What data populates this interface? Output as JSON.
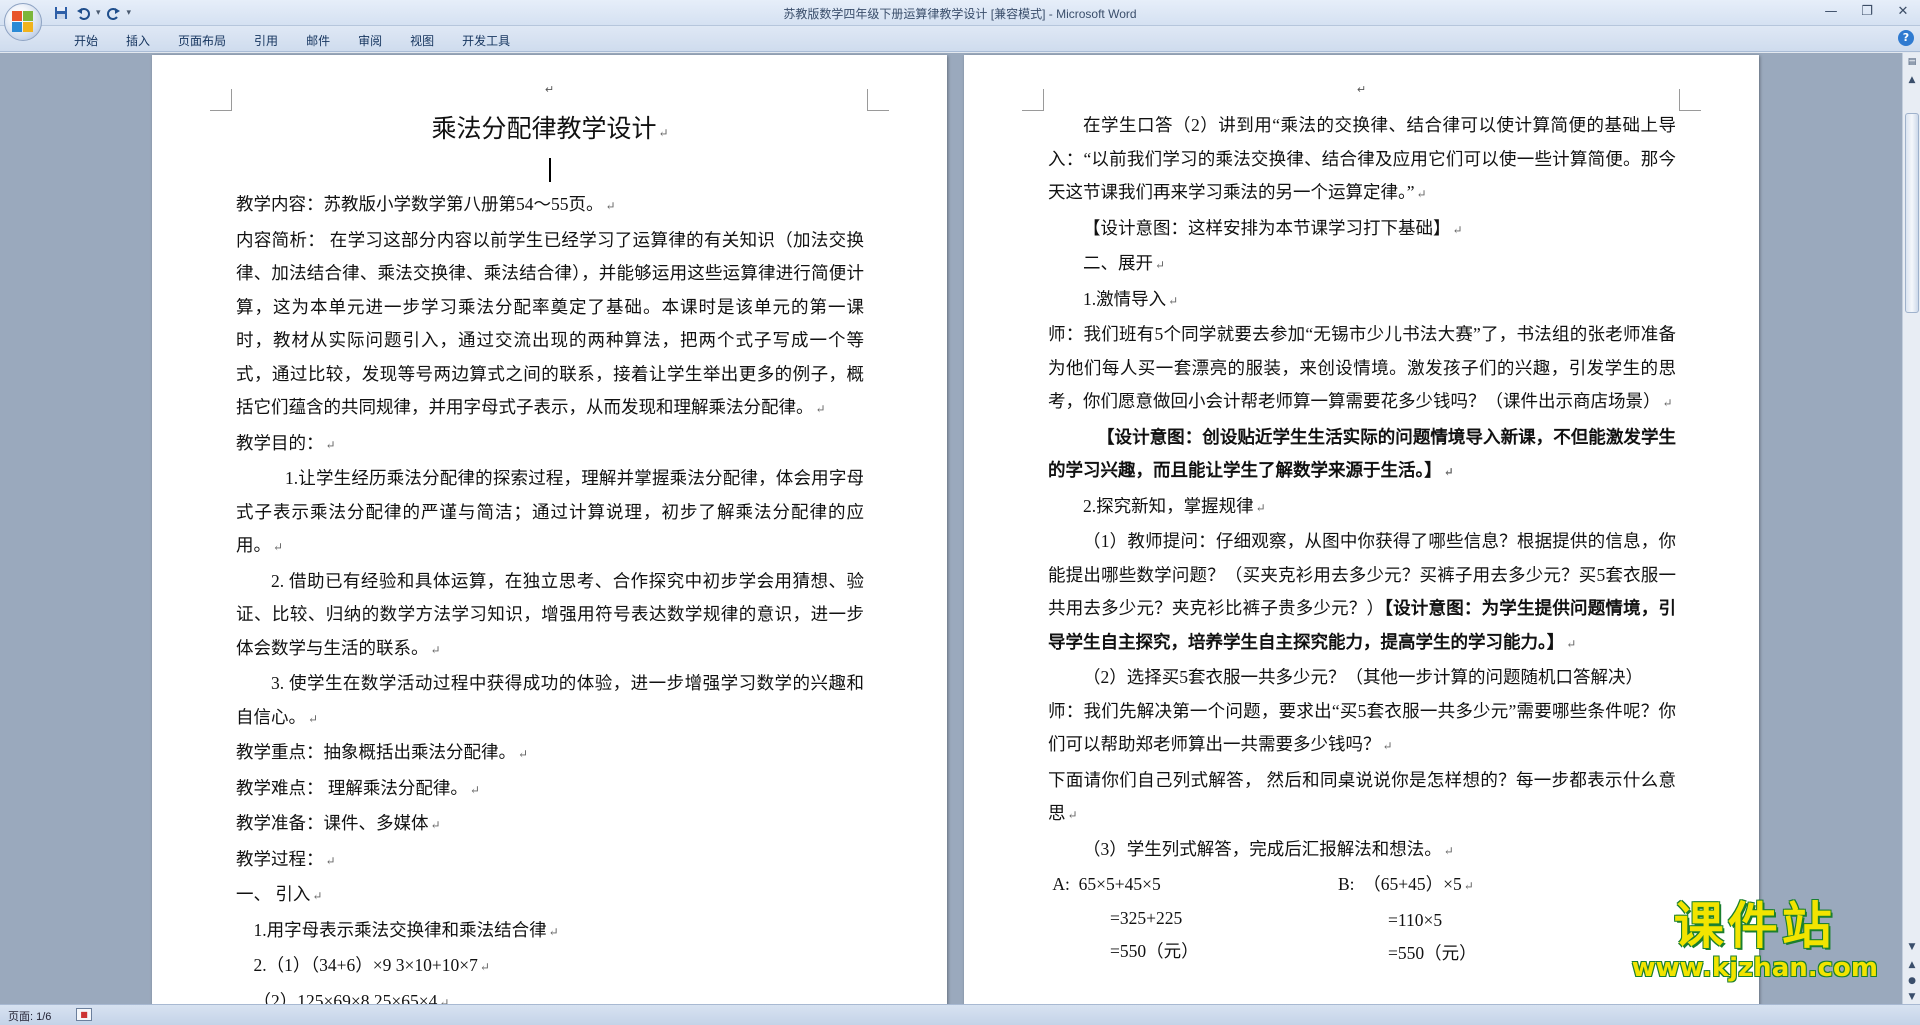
{
  "window": {
    "title": "苏教版数学四年级下册运算律教学设计 [兼容模式] - Microsoft Word"
  },
  "ribbon": {
    "tabs": [
      "开始",
      "插入",
      "页面布局",
      "引用",
      "邮件",
      "审阅",
      "视图",
      "开发工具"
    ]
  },
  "qat": {
    "save_icon": "save-icon",
    "undo_icon": "undo-icon",
    "redo_icon": "redo-icon"
  },
  "left_page": {
    "title": "乘法分配律教学设计",
    "paragraphs": [
      "教学内容：苏教版小学数学第八册第54～55页。",
      "内容简析： 在学习这部分内容以前学生已经学习了运算律的有关知识（加法交换律、加法结合律、乘法交换律、乘法结合律），并能够运用这些运算律进行简便计算，这为本单元进一步学习乘法分配率奠定了基础。本课时是该单元的第一课时，教材从实际问题引入，通过交流出现的两种算法，把两个式子写成一个等式，通过比较，发现等号两边算式之间的联系，接着让学生举出更多的例子，概括它们蕴含的共同规律，并用字母式子表示，从而发现和理解乘法分配律。",
      "教学目的：",
      "1.让学生经历乘法分配律的探索过程，理解并掌握乘法分配律，体会用字母式子表示乘法分配律的严谨与简洁；通过计算说理，初步了解乘法分配律的应用。",
      "2. 借助已有经验和具体运算，在独立思考、合作探究中初步学会用猜想、验证、比较、归纳的数学方法学习知识，增强用符号表达数学规律的意识，进一步体会数学与生活的联系。",
      "3. 使学生在数学活动过程中获得成功的体验，进一步增强学习数学的兴趣和自信心。",
      "教学重点：抽象概括出乘法分配律。",
      "教学难点： 理解乘法分配律。",
      "教学准备：课件、多媒体",
      "教学过程：",
      "一、 引入",
      "1.用字母表示乘法交换律和乘法结合律",
      "2.（1）（34+6）×9     3×10+10×7",
      "（2）125×69×8       25×65×4"
    ]
  },
  "right_page": {
    "paragraphs": [
      "在学生口答（2）讲到用“乘法的交换律、结合律可以使计算简便的基础上导入：“以前我们学习的乘法交换律、结合律及应用它们可以使一些计算简便。那今天这节课我们再来学习乘法的另一个运算定律。”",
      "【设计意图：这样安排为本节课学习打下基础】",
      "二、展开",
      "1.激情导入",
      "师：我们班有5个同学就要去参加“无锡市少儿书法大赛”了，书法组的张老师准备为他们每人买一套漂亮的服装，来创设情境。激发孩子们的兴趣，引发学生的思考，你们愿意做回小会计帮老师算一算需要花多少钱吗？（课件出示商店场景）",
      "【设计意图：创设贴近学生生活实际的问题情境导入新课，不但能激发学生的学习兴趣，而且能让学生了解数学来源于生活。】",
      "2.探究新知，掌握规律",
      "（1）教师提问：仔细观察，从图中你获得了哪些信息？根据提供的信息，你能提出哪些数学问题？（买夹克衫用去多少元？买裤子用去多少元？买5套衣服一共用去多少元？夹克衫比裤子贵多少元？）",
      "【设计意图：为学生提供问题情境，引导学生自主探究，培养学生自主探究能力，提高学生的学习能力。】",
      "（2）选择买5套衣服一共多少元？（其他一步计算的问题随机口答解决）",
      "师：我们先解决第一个问题，要求出“买5套衣服一共多少元”需要哪些条件呢？你们可以帮助郑老师算出一共需要多少钱吗？",
      "下面请你们自己列式解答， 然后和同桌说说你是怎样想的？每一步都表示什么意思",
      "（3）学生列式解答，完成后汇报解法和想法。"
    ],
    "equations": {
      "a_label": "A:",
      "b_label": "B:",
      "a_lines": [
        "65×5+45×5",
        "=325+225",
        "=550（元）"
      ],
      "b_lines": [
        "（65+45）×5",
        "=110×5",
        "=550（元）"
      ]
    }
  },
  "status": {
    "page": "页面: 1/6"
  },
  "watermark": {
    "main": "课件站",
    "url": "www.kjzhan.com"
  }
}
